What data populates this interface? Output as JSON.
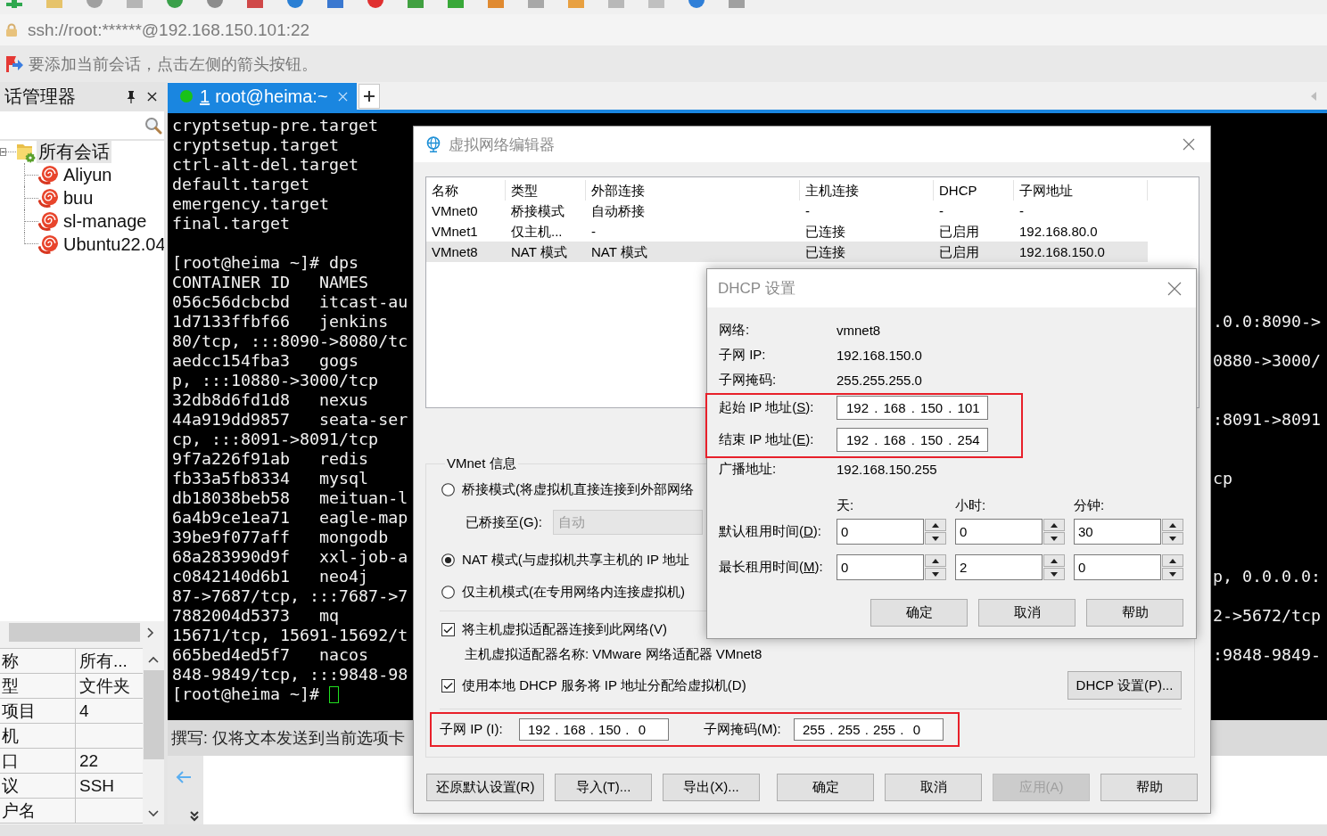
{
  "address_bar": {
    "text": "ssh://root:******@192.168.150.101:22"
  },
  "hint_bar": {
    "text": "要添加当前会话，点击左侧的箭头按钮。"
  },
  "session_manager": {
    "title": "话管理器",
    "tree": [
      {
        "label": "所有会话",
        "expanded": true,
        "selected": true,
        "children": [
          {
            "label": "Aliyun",
            "selected": false
          },
          {
            "label": "buu",
            "selected": false
          },
          {
            "label": "sl-manage",
            "selected": false
          },
          {
            "label": "Ubuntu22.04",
            "selected": false
          }
        ]
      }
    ],
    "properties": [
      {
        "name": "称",
        "value": "所有..."
      },
      {
        "name": "型",
        "value": "文件夹"
      },
      {
        "name": "项目",
        "value": "4"
      },
      {
        "name": "机"
      },
      {
        "name": "口",
        "value": "22"
      },
      {
        "name": "议",
        "value": "SSH"
      },
      {
        "name": "户名"
      }
    ]
  },
  "tabs": [
    {
      "number": "1",
      "title": "root@heima:~",
      "selected": true,
      "connected": true
    }
  ],
  "terminal": {
    "blocks": [
      [
        {
          "text": "cryptsetup-pre.target"
        },
        {
          "text": "cryptsetup.target"
        },
        {
          "text": "ctrl-alt-del.target"
        },
        {
          "text": "default.target"
        },
        {
          "text": "emergency.target"
        },
        {
          "text": "final.target"
        }
      ],
      [
        {
          "text": "[root@heima ~]# dps"
        },
        {
          "text": "CONTAINER ID   NAMES"
        },
        {
          "text": "056c56dcbcbd   itcast-au"
        },
        {
          "text": "1d7133ffbf66   jenkins",
          "tail": ".0.0:8090->"
        },
        {
          "text": "80/tcp, :::8090->8080/tc"
        },
        {
          "text": "aedcc154fba3   gogs",
          "tail": "0880->3000/"
        },
        {
          "text": "p, :::10880->3000/tcp"
        },
        {
          "text": "32db8d6fd1d8   nexus"
        },
        {
          "text": "44a919dd9857   seata-ser",
          "tail": ":8091->8091"
        },
        {
          "text": "cp, :::8091->8091/tcp"
        },
        {
          "text": "9f7a226f91ab   redis"
        },
        {
          "text": "fb33a5fb8334   mysql",
          "tail": "cp"
        },
        {
          "text": "db18038beb58   meituan-l"
        },
        {
          "text": "6a4b9ce1ea71   eagle-map"
        },
        {
          "text": "39be9f077aff   mongodb"
        },
        {
          "text": "68a283990d9f   xxl-job-a"
        },
        {
          "text": "c0842140d6b1   neo4j",
          "tail": "p, 0.0.0.0:"
        },
        {
          "text": "87->7687/tcp, :::7687->7"
        },
        {
          "text": "7882004d5373   mq",
          "tail": "2->5672/tcp"
        },
        {
          "text": "15671/tcp, 15691-15692/t"
        },
        {
          "text": "665bed4ed5f7   nacos",
          "tail": ":9848-9849-"
        },
        {
          "text": "848-9849/tcp, :::9848-98"
        },
        {
          "text": "[root@heima ~]#",
          "cursor": true
        }
      ]
    ]
  },
  "compose_bar": {
    "text": "撰写: 仅将文本发送到当前选项卡"
  },
  "network_editor": {
    "title": "虚拟网络编辑器",
    "table": {
      "columns": [
        "名称",
        "类型",
        "外部连接",
        "主机连接",
        "DHCP",
        "子网地址"
      ],
      "rows": [
        {
          "cells": [
            "VMnet0",
            "桥接模式",
            "自动桥接",
            "-",
            "-",
            "-"
          ],
          "selected": false
        },
        {
          "cells": [
            "VMnet1",
            "仅主机...",
            "-",
            "已连接",
            "已启用",
            "192.168.80.0"
          ],
          "selected": false
        },
        {
          "cells": [
            "VMnet8",
            "NAT 模式",
            "NAT 模式",
            "已连接",
            "已启用",
            "192.168.150.0"
          ],
          "selected": true
        }
      ]
    },
    "vmnet_info": {
      "title": "VMnet 信息",
      "modes": [
        {
          "label": "桥接模式(将虚拟机直接连接到外部网络",
          "selected": false,
          "bridged_to": {
            "label": "已桥接至(G):",
            "value": "自动",
            "disabled": true
          }
        },
        {
          "label": "NAT 模式(与虚拟机共享主机的 IP 地址",
          "selected": true
        },
        {
          "label": "仅主机模式(在专用网络内连接虚拟机)",
          "selected": false
        }
      ],
      "options": [
        {
          "label": "将主机虚拟适配器连接到此网络(V)",
          "checked": true,
          "note": "主机虚拟适配器名称: VMware 网络适配器 VMnet8"
        },
        {
          "label": "使用本地 DHCP 服务将 IP 地址分配给虚拟机(D)",
          "checked": true,
          "button": "DHCP 设置(P)..."
        }
      ],
      "subnet": {
        "highlighted": true,
        "fields": [
          {
            "label": "子网 IP (I):",
            "value": "192 . 168 . 150 .  0"
          },
          {
            "label": "子网掩码(M):",
            "value": "255 . 255 . 255 .  0"
          }
        ]
      }
    },
    "buttons": [
      {
        "label": "还原默认设置(R)",
        "disabled": false
      },
      {
        "label": "导入(T)...",
        "disabled": false
      },
      {
        "label": "导出(X)...",
        "disabled": false
      },
      {
        "label": "确定",
        "disabled": false
      },
      {
        "label": "取消",
        "disabled": false
      },
      {
        "label": "应用(A)",
        "disabled": true
      },
      {
        "label": "帮助",
        "disabled": false
      }
    ]
  },
  "dhcp_dialog": {
    "title": "DHCP 设置",
    "info": [
      {
        "label": "网络:",
        "value": "vmnet8"
      },
      {
        "label": "子网 IP:",
        "value": "192.168.150.0"
      },
      {
        "label": "子网掩码:",
        "value": "255.255.255.0"
      }
    ],
    "range": {
      "highlighted": true,
      "fields": [
        {
          "label": "起始 IP 地址(",
          "mnemonic": "S",
          "label_end": "):",
          "value": "192 . 168 . 150 . 101"
        },
        {
          "label": "结束 IP 地址(",
          "mnemonic": "E",
          "label_end": "):",
          "value": "192 . 168 . 150 . 254"
        }
      ]
    },
    "broadcast": {
      "label": "广播地址:",
      "value": "192.168.150.255"
    },
    "lease_columns": [
      "天:",
      "小时:",
      "分钟:"
    ],
    "leases": [
      {
        "label": "默认租用时间(",
        "mnemonic": "D",
        "label_end": "):",
        "values": [
          "0",
          "0",
          "30"
        ]
      },
      {
        "label": "最长租用时间(",
        "mnemonic": "M",
        "label_end": "):",
        "values": [
          "0",
          "2",
          "0"
        ]
      }
    ],
    "buttons": [
      "确定",
      "取消",
      "帮助"
    ]
  }
}
